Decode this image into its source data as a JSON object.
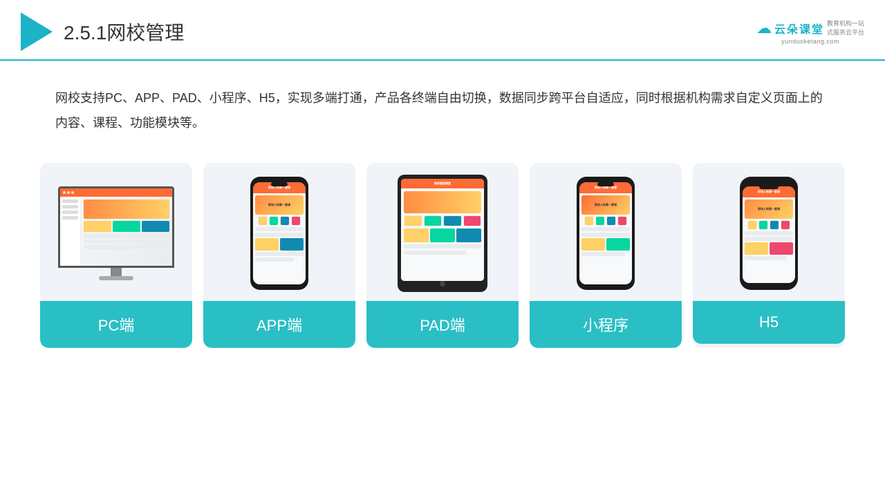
{
  "header": {
    "title_num": "2.5.1",
    "title_cn": "网校管理",
    "brand_cn": "云朵课堂",
    "brand_en": "yunduoketang.com",
    "brand_tagline": "教育机构一站\n式服务云平台"
  },
  "description": "网校支持PC、APP、PAD、小程序、H5，实现多端打通，产品各终端自由切换，数据同步跨平台自适应，同时根据机构需求自定义页面上的内容、课程、功能模块等。",
  "cards": [
    {
      "id": "pc",
      "label": "PC端"
    },
    {
      "id": "app",
      "label": "APP端"
    },
    {
      "id": "pad",
      "label": "PAD端"
    },
    {
      "id": "miniprogram",
      "label": "小程序"
    },
    {
      "id": "h5",
      "label": "H5"
    }
  ],
  "accent_color": "#2abfc5"
}
